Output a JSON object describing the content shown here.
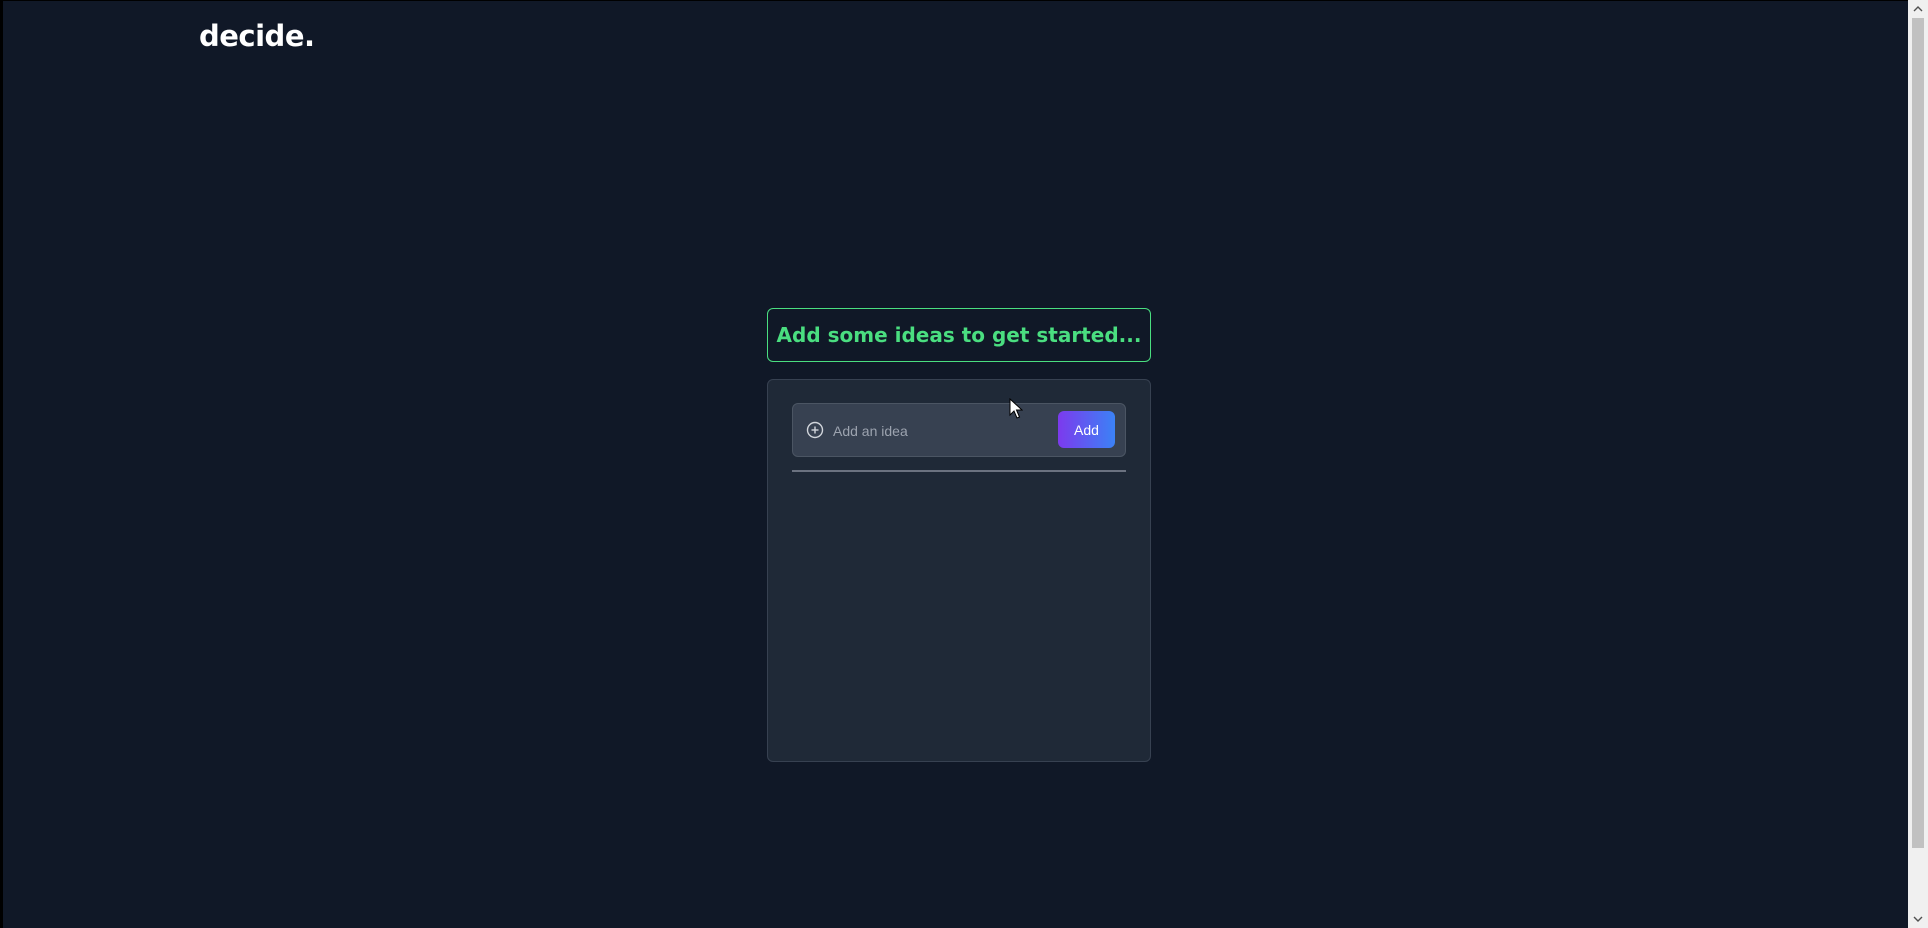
{
  "header": {
    "logo_text": "decide."
  },
  "banner": {
    "message": "Add some ideas to get started..."
  },
  "idea_form": {
    "input_value": "",
    "input_placeholder": "Add an idea",
    "add_label": "Add",
    "icon": "plus-circle-icon"
  },
  "ideas": [],
  "colors": {
    "background": "#101827",
    "card": "#1f2937",
    "accent_green": "#4ade80",
    "button_gradient_start": "#7c3aed",
    "button_gradient_end": "#3b82f6"
  }
}
